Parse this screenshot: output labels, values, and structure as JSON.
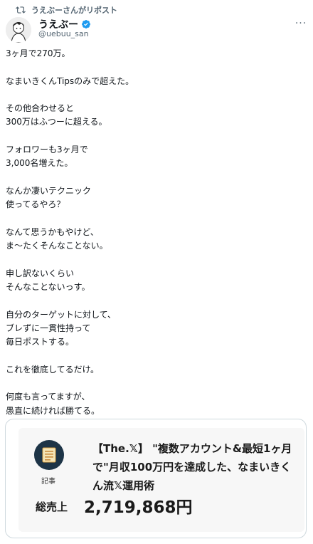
{
  "repost": {
    "label": "うえぶーさんがリポスト",
    "icon": "repost-icon"
  },
  "author": {
    "display_name": "うえぶー",
    "handle": "@uebuu_san",
    "verified_color": "#1d9bf0"
  },
  "tweet": {
    "text": "3ヶ月で270万。\n\nなまいきくんTipsのみで超えた。\n\nその他合わせると\n300万はふつーに超える。\n\nフォロワーも3ヶ月で\n3,000名増えた。\n\nなんか凄いテクニック\n使ってるやろ？\n\nなんて思うかもやけど、\nま〜たくそんなことない。\n\n申し訳ないくらい\nそんなことないっす。\n\n自分のターゲットに対して、\nブレずに一貫性持って\n毎日ポストする。\n\nこれを徹底してるだけ。\n\n何度も言ってますが、\n愚直に続ければ勝てる。"
  },
  "card": {
    "article_label": "記事",
    "title": "【The.𝕏】 \"複数アカウント&最短1ヶ月で\"月収100万円を達成した、なまいきくん流𝕏運用術",
    "sales_label": "総売上",
    "sales_value": "2,719,868円",
    "accent_color": "#1d3447"
  }
}
